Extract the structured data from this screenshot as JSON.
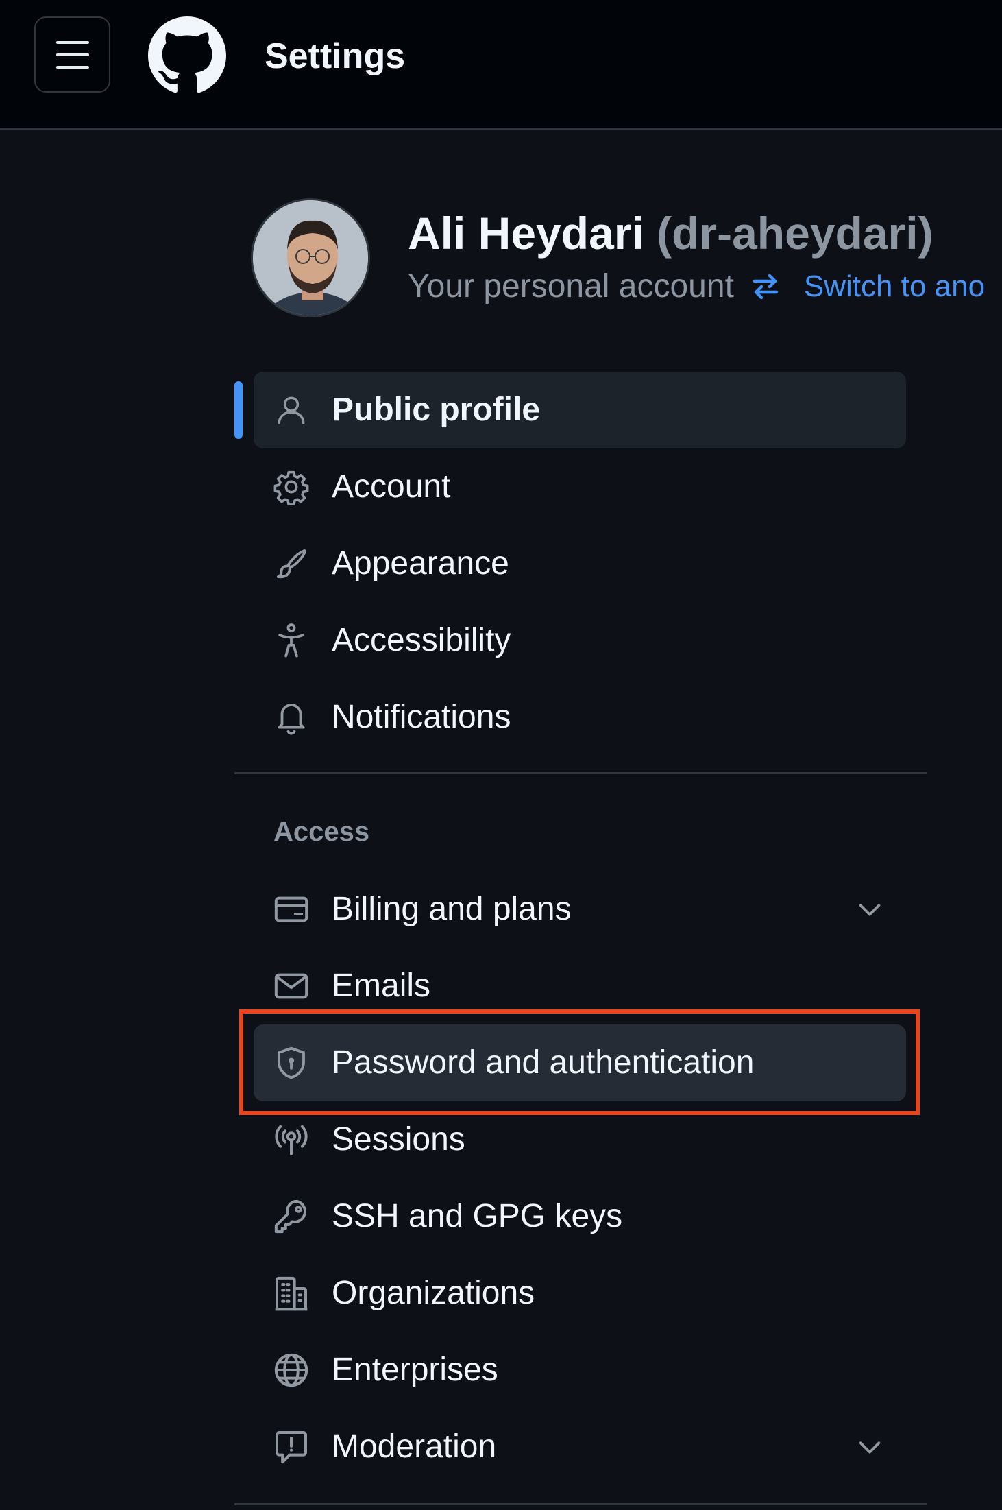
{
  "header": {
    "menu_icon": "hamburger-icon",
    "logo_icon": "github-logo-icon",
    "title": "Settings"
  },
  "profile": {
    "name": "Ali Heydari",
    "login": "(dr-aheydari)",
    "subtitle": "Your personal account",
    "switch_icon": "arrow-switch-icon",
    "switch_label": "Switch to ano"
  },
  "nav": {
    "items": [
      {
        "label": "Public profile",
        "icon": "person-icon",
        "selected": true
      },
      {
        "label": "Account",
        "icon": "gear-icon"
      },
      {
        "label": "Appearance",
        "icon": "paintbrush-icon"
      },
      {
        "label": "Accessibility",
        "icon": "accessibility-icon"
      },
      {
        "label": "Notifications",
        "icon": "bell-icon"
      }
    ],
    "access_heading": "Access",
    "access_items": [
      {
        "label": "Billing and plans",
        "icon": "credit-card-icon",
        "expandable": true
      },
      {
        "label": "Emails",
        "icon": "mail-icon"
      },
      {
        "label": "Password and authentication",
        "icon": "shield-lock-icon",
        "highlighted": true
      },
      {
        "label": "Sessions",
        "icon": "broadcast-icon"
      },
      {
        "label": "SSH and GPG keys",
        "icon": "key-icon"
      },
      {
        "label": "Organizations",
        "icon": "organization-icon"
      },
      {
        "label": "Enterprises",
        "icon": "globe-icon"
      },
      {
        "label": "Moderation",
        "icon": "report-icon",
        "expandable": true
      }
    ]
  },
  "colors": {
    "background": "#0d1117",
    "header_bg": "#010409",
    "accent": "#4493f8",
    "highlight_border": "#e8451f"
  }
}
